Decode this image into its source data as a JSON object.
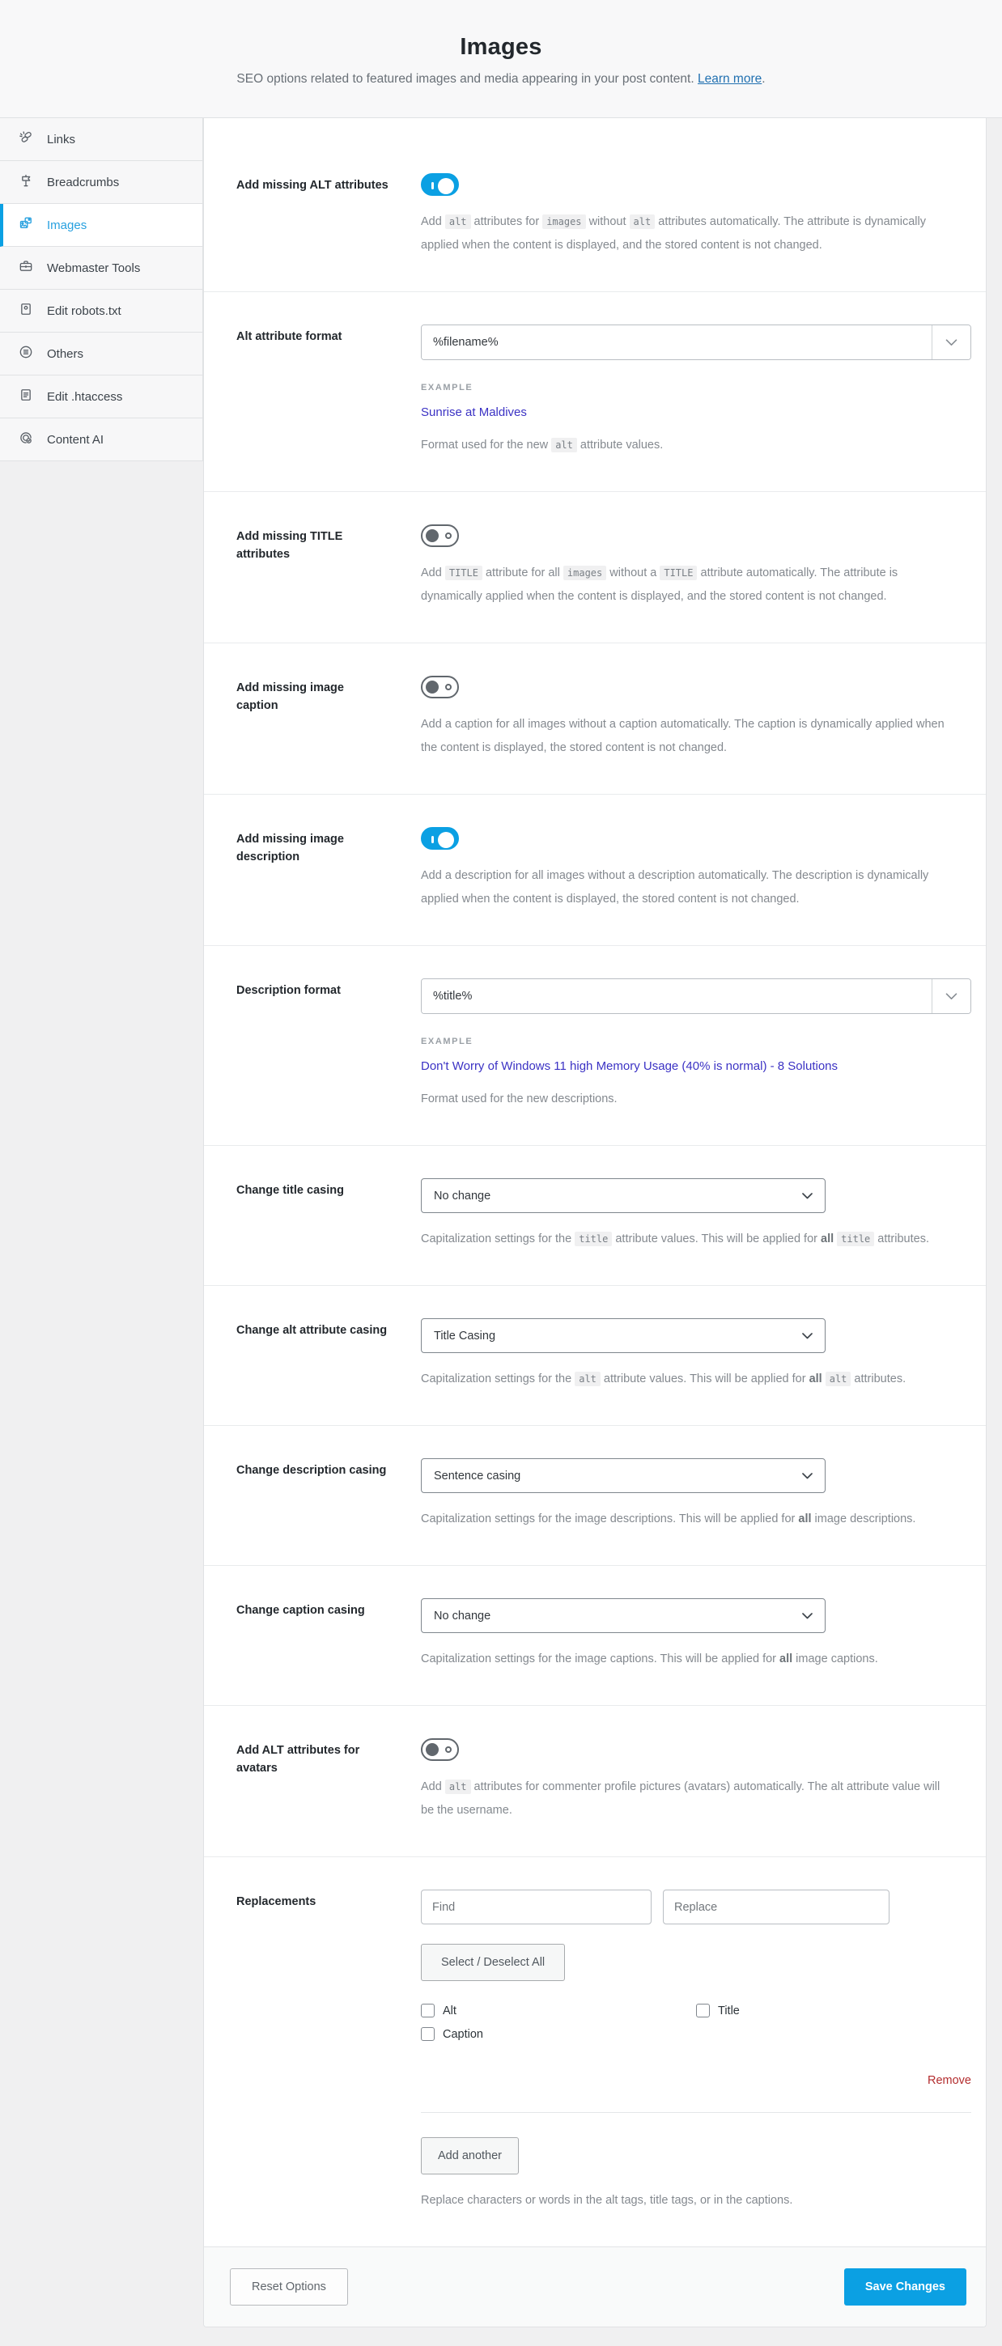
{
  "header": {
    "title": "Images",
    "subtitle": [
      {
        "t": "text",
        "v": "SEO options related to featured images and media appearing in your post content. "
      },
      {
        "t": "link",
        "v": "Learn more"
      },
      {
        "t": "text",
        "v": "."
      }
    ]
  },
  "sidebar": {
    "items": [
      {
        "label": "Links",
        "icon": "broken-link-icon",
        "active": false
      },
      {
        "label": "Breadcrumbs",
        "icon": "signpost-icon",
        "active": false
      },
      {
        "label": "Images",
        "icon": "images-icon",
        "active": true
      },
      {
        "label": "Webmaster Tools",
        "icon": "toolbox-icon",
        "active": false
      },
      {
        "label": "Edit robots.txt",
        "icon": "robots-file-icon",
        "active": false
      },
      {
        "label": "Others",
        "icon": "list-circle-icon",
        "active": false
      },
      {
        "label": "Edit .htaccess",
        "icon": "document-icon",
        "active": false
      },
      {
        "label": "Content AI",
        "icon": "fingerprint-check-icon",
        "active": false
      }
    ]
  },
  "rows": {
    "alt_attributes": {
      "label": "Add missing ALT attributes",
      "enabled": true,
      "description": [
        {
          "t": "text",
          "v": "Add "
        },
        {
          "t": "code",
          "v": "alt"
        },
        {
          "t": "text",
          "v": " attributes for "
        },
        {
          "t": "code",
          "v": "images"
        },
        {
          "t": "text",
          "v": " without "
        },
        {
          "t": "code",
          "v": "alt"
        },
        {
          "t": "text",
          "v": " attributes automatically. The attribute is dynamically applied when the content is displayed, and the stored content is not changed."
        }
      ]
    },
    "alt_format": {
      "label": "Alt attribute format",
      "value": "%filename%",
      "example_label": "EXAMPLE",
      "example": "Sunrise at Maldives",
      "description": [
        {
          "t": "text",
          "v": "Format used for the new "
        },
        {
          "t": "code",
          "v": "alt"
        },
        {
          "t": "text",
          "v": " attribute values."
        }
      ]
    },
    "title_attributes": {
      "label": "Add missing TITLE attributes",
      "enabled": false,
      "description": [
        {
          "t": "text",
          "v": "Add "
        },
        {
          "t": "code",
          "v": "TITLE"
        },
        {
          "t": "text",
          "v": " attribute for all "
        },
        {
          "t": "code",
          "v": "images"
        },
        {
          "t": "text",
          "v": " without a "
        },
        {
          "t": "code",
          "v": "TITLE"
        },
        {
          "t": "text",
          "v": " attribute automatically. The attribute is dynamically applied when the content is displayed, and the stored content is not changed."
        }
      ]
    },
    "image_caption": {
      "label": "Add missing image caption",
      "enabled": false,
      "description": [
        {
          "t": "text",
          "v": "Add a caption for all images without a caption automatically. The caption is dynamically applied when the content is displayed, the stored content is not changed."
        }
      ]
    },
    "image_description": {
      "label": "Add missing image description",
      "enabled": true,
      "description": [
        {
          "t": "text",
          "v": "Add a description for all images without a description automatically. The description is dynamically applied when the content is displayed, the stored content is not changed."
        }
      ]
    },
    "description_format": {
      "label": "Description format",
      "value": "%title%",
      "example_label": "EXAMPLE",
      "example": "Don't Worry of Windows 11 high Memory Usage (40% is normal) - 8 Solutions",
      "description": [
        {
          "t": "text",
          "v": "Format used for the new descriptions."
        }
      ]
    },
    "title_casing": {
      "label": "Change title casing",
      "value": "No change",
      "description": [
        {
          "t": "text",
          "v": "Capitalization settings for the "
        },
        {
          "t": "code",
          "v": "title"
        },
        {
          "t": "text",
          "v": " attribute values. This will be applied for "
        },
        {
          "t": "b",
          "v": "all"
        },
        {
          "t": "text",
          "v": " "
        },
        {
          "t": "code",
          "v": "title"
        },
        {
          "t": "text",
          "v": " attributes."
        }
      ]
    },
    "alt_casing": {
      "label": "Change alt attribute casing",
      "value": "Title Casing",
      "description": [
        {
          "t": "text",
          "v": "Capitalization settings for the "
        },
        {
          "t": "code",
          "v": "alt"
        },
        {
          "t": "text",
          "v": " attribute values. This will be applied for "
        },
        {
          "t": "b",
          "v": "all"
        },
        {
          "t": "text",
          "v": " "
        },
        {
          "t": "code",
          "v": "alt"
        },
        {
          "t": "text",
          "v": " attributes."
        }
      ]
    },
    "description_casing": {
      "label": "Change description casing",
      "value": "Sentence casing",
      "description": [
        {
          "t": "text",
          "v": "Capitalization settings for the image descriptions. This will be applied for "
        },
        {
          "t": "b",
          "v": "all"
        },
        {
          "t": "text",
          "v": " image descriptions."
        }
      ]
    },
    "caption_casing": {
      "label": "Change caption casing",
      "value": "No change",
      "description": [
        {
          "t": "text",
          "v": "Capitalization settings for the image captions. This will be applied for "
        },
        {
          "t": "b",
          "v": "all"
        },
        {
          "t": "text",
          "v": " image captions."
        }
      ]
    },
    "avatar_alt": {
      "label": "Add ALT attributes for avatars",
      "enabled": false,
      "description": [
        {
          "t": "text",
          "v": "Add "
        },
        {
          "t": "code",
          "v": "alt"
        },
        {
          "t": "text",
          "v": " attributes for commenter profile pictures (avatars) automatically. The alt attribute value will be the username."
        }
      ]
    },
    "replacements": {
      "label": "Replacements",
      "find_placeholder": "Find",
      "replace_placeholder": "Replace",
      "select_all_label": "Select / Deselect All",
      "checkboxes": [
        {
          "label": "Alt",
          "checked": false
        },
        {
          "label": "Title",
          "checked": false
        },
        {
          "label": "Caption",
          "checked": false
        }
      ],
      "remove_label": "Remove",
      "add_another_label": "Add another",
      "description": [
        {
          "t": "text",
          "v": "Replace characters or words in the alt tags, title tags, or in the captions."
        }
      ]
    }
  },
  "footer": {
    "reset_label": "Reset Options",
    "save_label": "Save Changes"
  },
  "colors": {
    "accent_blue": "#0ba0e3",
    "learn_more_link": "#2271b1",
    "example_link": "#3b32c4",
    "remove_red": "#b32d2e",
    "page_background": "#f0f0f1"
  }
}
